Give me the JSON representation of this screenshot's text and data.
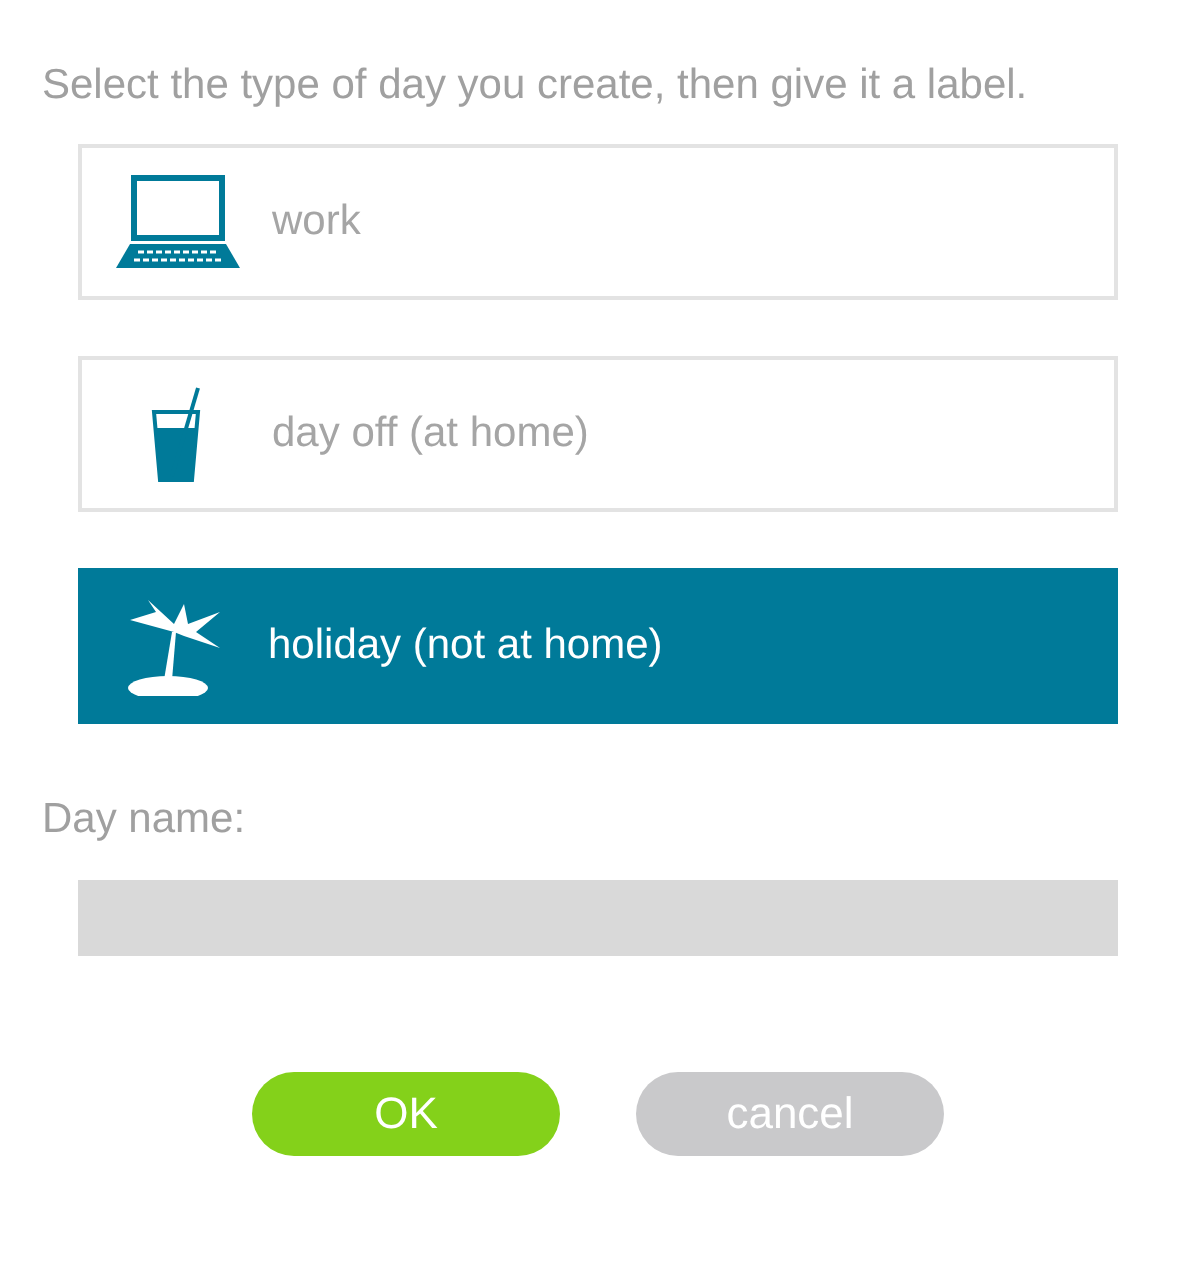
{
  "instruction": "Select the type of day you create, then give it a label.",
  "options": [
    {
      "kind": "laptop",
      "label": "work",
      "selected": false
    },
    {
      "kind": "drink",
      "label": "day off (at home)",
      "selected": false
    },
    {
      "kind": "palm",
      "label": "holiday (not at home)",
      "selected": true
    }
  ],
  "day_name": {
    "label": "Day name:"
  },
  "buttons": [
    {
      "kind": "primary",
      "label": "OK"
    },
    {
      "kind": "secondary",
      "label": "cancel"
    }
  ]
}
